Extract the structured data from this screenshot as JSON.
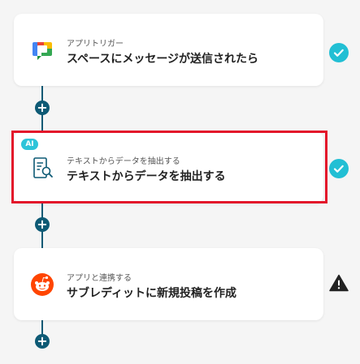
{
  "flow": {
    "steps": [
      {
        "category": "アプリトリガー",
        "title": "スペースにメッセージが送信されたら",
        "app_icon": "google-chat-icon",
        "status": "complete"
      },
      {
        "category": "テキストからデータを抽出する",
        "title": "テキストからデータを抽出する",
        "app_icon": "document-search-icon",
        "badge": "AI",
        "status": "complete"
      },
      {
        "category": "アプリと連携する",
        "title": "サブレディットに新規投稿を作成",
        "app_icon": "reddit-icon",
        "status": "warning"
      }
    ],
    "add_step_label": "+"
  },
  "colors": {
    "connector": "#0d5a75",
    "status_ok": "#22bfd4",
    "ai_badge": "#2ec4d9",
    "selection": "#e3142a",
    "warning": "#222222"
  }
}
